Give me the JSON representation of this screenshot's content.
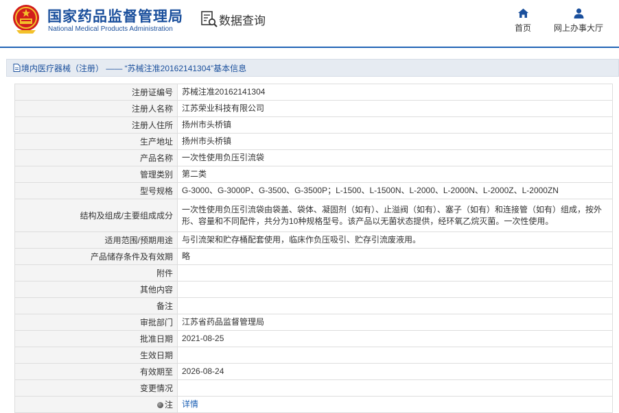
{
  "header": {
    "org_name_cn": "国家药品监督管理局",
    "org_name_en": "National Medical Products Administration",
    "section_title": "数据查询",
    "nav": [
      {
        "label": "首页",
        "icon": "home-icon"
      },
      {
        "label": "网上办事大厅",
        "icon": "user-icon"
      }
    ]
  },
  "breadcrumb": {
    "text": "境内医疗器械（注册） —— “苏械注准20162141304”基本信息"
  },
  "record": {
    "rows": [
      {
        "label": "注册证编号",
        "value": "苏械注准20162141304"
      },
      {
        "label": "注册人名称",
        "value": "江苏荣业科技有限公司"
      },
      {
        "label": "注册人住所",
        "value": "扬州市头桥镇"
      },
      {
        "label": "生产地址",
        "value": "扬州市头桥镇"
      },
      {
        "label": "产品名称",
        "value": "一次性使用负压引流袋"
      },
      {
        "label": "管理类别",
        "value": "第二类"
      },
      {
        "label": "型号规格",
        "value": "G-3000、G-3000P、G-3500、G-3500P；L-1500、L-1500N、L-2000、L-2000N、L-2000Z、L-2000ZN"
      },
      {
        "label": "结构及组成/主要组成成分",
        "value": "一次性使用负压引流袋由袋盖、袋体、凝固剂（如有）、止溢阀（如有）、塞子（如有）和连接管（如有）组成，按外形、容量和不同配件，共分为10种规格型号。该产品以无菌状态提供，经环氧乙烷灭菌。一次性使用。"
      },
      {
        "label": "适用范围/预期用途",
        "value": "与引流架和贮存桶配套使用，临床作负压吸引、贮存引流废液用。"
      },
      {
        "label": "产品储存条件及有效期",
        "value": "略"
      },
      {
        "label": "附件",
        "value": ""
      },
      {
        "label": "其他内容",
        "value": ""
      },
      {
        "label": "备注",
        "value": ""
      },
      {
        "label": "审批部门",
        "value": "江苏省药品监督管理局"
      },
      {
        "label": "批准日期",
        "value": "2021-08-25"
      },
      {
        "label": "生效日期",
        "value": ""
      },
      {
        "label": "有效期至",
        "value": "2026-08-24"
      },
      {
        "label": "变更情况",
        "value": ""
      }
    ],
    "note": {
      "label": "注",
      "link": "详情"
    }
  },
  "colors": {
    "brand_blue": "#1a4f9c",
    "header_line": "#1f62b5",
    "label_bg": "#f4f4f4",
    "link": "#1a5fb4"
  }
}
